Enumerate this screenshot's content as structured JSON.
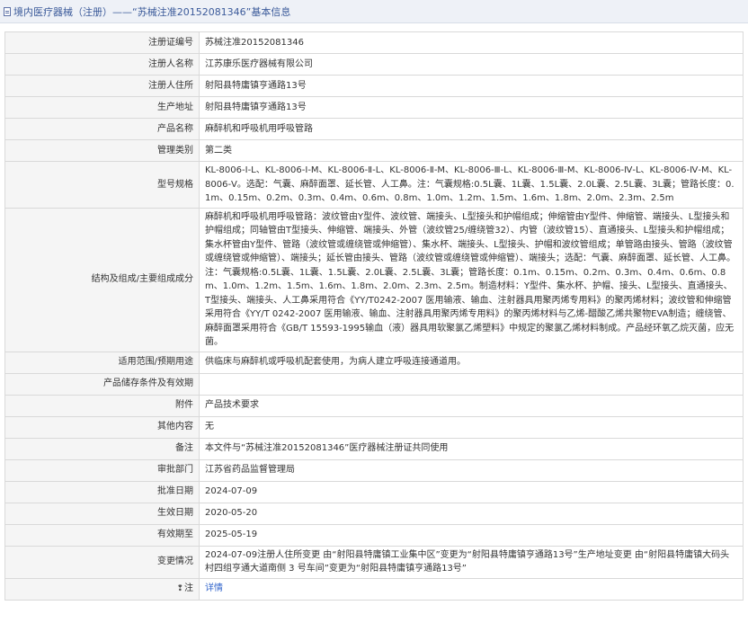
{
  "header": {
    "title": "境内医疗器械（注册）——“苏械注准20152081346”基本信息"
  },
  "rows": [
    {
      "label": "注册证编号",
      "value": "苏械注准20152081346"
    },
    {
      "label": "注册人名称",
      "value": "江苏康乐医疗器械有限公司"
    },
    {
      "label": "注册人住所",
      "value": "射阳县特庸镇亨通路13号"
    },
    {
      "label": "生产地址",
      "value": "射阳县特庸镇亨通路13号"
    },
    {
      "label": "产品名称",
      "value": "麻醉机和呼吸机用呼吸管路"
    },
    {
      "label": "管理类别",
      "value": "第二类"
    },
    {
      "label": "型号规格",
      "value": "KL-8006-Ⅰ-L、KL-8006-Ⅰ-M、KL-8006-Ⅱ-L、KL-8006-Ⅱ-M、KL-8006-Ⅲ-L、KL-8006-Ⅲ-M、KL-8006-Ⅳ-L、KL-8006-Ⅳ-M、KL-8006-Ⅴ。选配：气囊、麻醉面罩、延长管、人工鼻。注：气囊规格:0.5L囊、1L囊、1.5L囊、2.0L囊、2.5L囊、3L囊；管路长度：0.1m、0.15m、0.2m、0.3m、0.4m、0.6m、0.8m、1.0m、1.2m、1.5m、1.6m、1.8m、2.0m、2.3m、2.5m"
    },
    {
      "label": "结构及组成/主要组成成分",
      "value": "麻醉机和呼吸机用呼吸管路：波纹管由Y型件、波纹管、端接头、L型接头和护帽组成；伸缩管由Y型件、伸缩管、端接头、L型接头和护帽组成；同轴管由T型接头、伸缩管、端接头、外管（波纹管25/缠绕管32）、内管（波纹管15）、直通接头、L型接头和护帽组成；集水杯管由Y型件、管路（波纹管或缠绕管或伸缩管）、集水杯、端接头、L型接头、护帽和波纹管组成；单管路由接头、管路（波纹管或缠绕管或伸缩管）、端接头；延长管由接头、管路（波纹管或缠绕管或伸缩管）、端接头；选配：气囊、麻醉面罩、延长管、人工鼻。注：气囊规格:0.5L囊、1L囊、1.5L囊、2.0L囊、2.5L囊、3L囊；管路长度：0.1m、0.15m、0.2m、0.3m、0.4m、0.6m、0.8m、1.0m、1.2m、1.5m、1.6m、1.8m、2.0m、2.3m、2.5m。制造材料：Y型件、集水杯、护帽、接头、L型接头、直通接头、T型接头、端接头、人工鼻采用符合《YY/T0242-2007 医用输液、输血、注射器具用聚丙烯专用料》的聚丙烯材料；波纹管和伸缩管采用符合《YY/T 0242-2007 医用输液、输血、注射器具用聚丙烯专用料》的聚丙烯材料与乙烯-醋酸乙烯共聚物EVA制造；缠绕管、麻醉面罩采用符合《GB/T 15593-1995输血（液）器具用软聚氯乙烯塑料》中规定的聚氯乙烯材料制成。产品经环氧乙烷灭菌，应无菌。"
    },
    {
      "label": "适用范围/预期用途",
      "value": "供临床与麻醉机或呼吸机配套使用，为病人建立呼吸连接通道用。"
    },
    {
      "label": "产品储存条件及有效期",
      "value": ""
    },
    {
      "label": "附件",
      "value": "产品技术要求"
    },
    {
      "label": "其他内容",
      "value": "无"
    },
    {
      "label": "备注",
      "value": "本文件与“苏械注准20152081346”医疗器械注册证共同使用"
    },
    {
      "label": "审批部门",
      "value": "江苏省药品监督管理局"
    },
    {
      "label": "批准日期",
      "value": "2024-07-09"
    },
    {
      "label": "生效日期",
      "value": "2020-05-20"
    },
    {
      "label": "有效期至",
      "value": "2025-05-19"
    },
    {
      "label": "变更情况",
      "value": "2024-07-09注册人住所变更 由“射阳县特庸镇工业集中区”变更为“射阳县特庸镇亨通路13号”生产地址变更 由“射阳县特庸镇大码头村四组亨通大道南侧 3 号车间”变更为“射阳县特庸镇亨通路13号”"
    }
  ],
  "note_row": {
    "icon_glyph": "❢",
    "label": "注",
    "link_text": "详情"
  },
  "colors": {
    "header_bg": "#eef1f7",
    "title_text": "#3b5a9a",
    "label_bg": "#f5f5f5",
    "border": "#d9d9d9",
    "link": "#3366cc"
  }
}
